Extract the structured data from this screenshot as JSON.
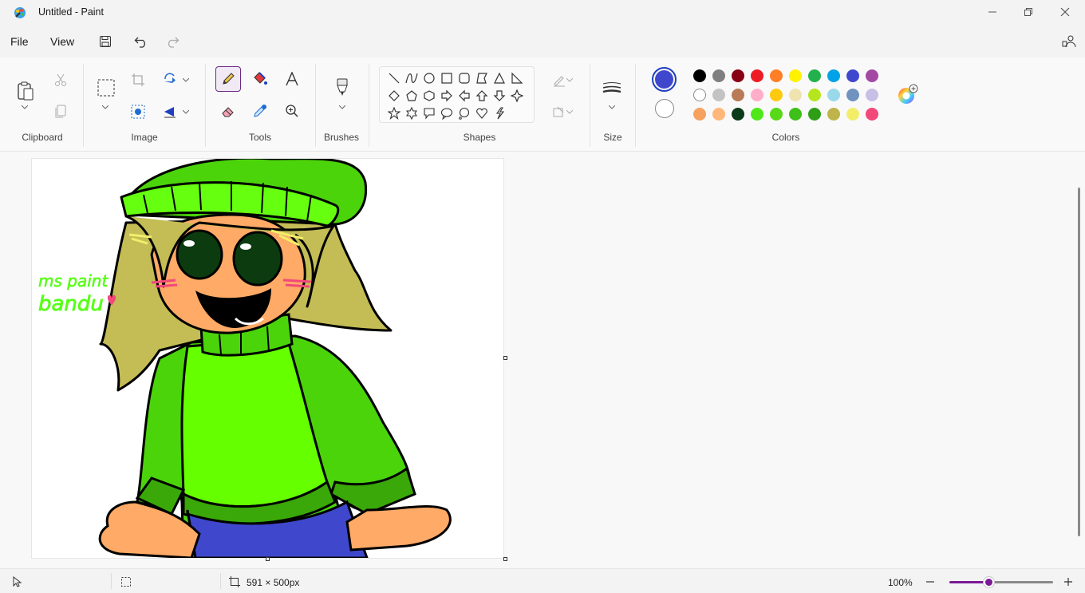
{
  "window": {
    "title": "Untitled - Paint"
  },
  "menu": {
    "file": "File",
    "view": "View"
  },
  "ribbon": {
    "groups": {
      "clipboard": "Clipboard",
      "image": "Image",
      "tools": "Tools",
      "brushes": "Brushes",
      "shapes": "Shapes",
      "size": "Size",
      "colors": "Colors"
    }
  },
  "colors": {
    "primary": "#3f48cc",
    "secondary": "#ffffff",
    "palette": [
      [
        "#000000",
        "#7f7f7f",
        "#880015",
        "#ed1c24",
        "#ff7f27",
        "#fff200",
        "#22b14c",
        "#00a2e8",
        "#3f48cc",
        "#a349a4"
      ],
      [
        "#ffffff",
        "#c3c3c3",
        "#b97a57",
        "#ffaec9",
        "#ffc90e",
        "#efe4b0",
        "#b5e61d",
        "#99d9ea",
        "#7092be",
        "#c8bfe7"
      ],
      [
        "#f7a15f",
        "#ffb77a",
        "#0c3b1a",
        "#4ee81a",
        "#57d917",
        "#3fbf1a",
        "#2e9e17",
        "#bfb44a",
        "#f2ee6a",
        "#f2487a"
      ]
    ]
  },
  "canvas": {
    "text_line1": "ms paint",
    "text_line2": "bandu"
  },
  "status": {
    "canvas_size": "591 × 500px",
    "zoom_label": "100%",
    "zoom_fraction": 0.38
  }
}
